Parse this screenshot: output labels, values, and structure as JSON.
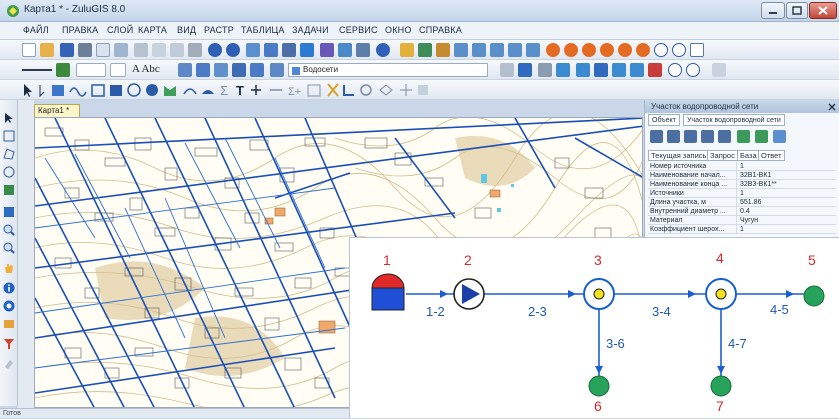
{
  "window": {
    "title": "Карта1 * - ZuluGIS 8.0"
  },
  "menu": [
    "ФАЙЛ",
    "ПРАВКА",
    "СЛОЙ",
    "КАРТА",
    "ВИД",
    "РАСТР",
    "ТАБЛИЦА",
    "ЗАДАЧИ",
    "СЕРВИС",
    "ОКНО",
    "СПРАВКА"
  ],
  "toolbar2": {
    "text_style": "A Abc",
    "layer_name": "Водосети"
  },
  "document_tab": "Карта1 *",
  "panel": {
    "title": "Участок водопроводной сети",
    "tab_object": "Объект",
    "tab_layer": "Участок водопроводной сети",
    "subtabs": [
      "Текущая запись",
      "Запрос",
      "База",
      "Ответ"
    ],
    "rows": [
      {
        "key": "Номер источника",
        "value": "1"
      },
      {
        "key": "Наименование начал...",
        "value": "32В1-ВК1"
      },
      {
        "key": "Наименование конца ...",
        "value": "32В3-ВК1**"
      },
      {
        "key": "Источники",
        "value": "1"
      },
      {
        "key": "Длина участка, м",
        "value": "551.86"
      },
      {
        "key": "Внутренний диаметр ...",
        "value": "0.4"
      },
      {
        "key": "Материал",
        "value": "Чугун"
      },
      {
        "key": "Коэффициент шерох...",
        "value": "1"
      }
    ]
  },
  "status": {
    "left": "Готов"
  },
  "diagram": {
    "nodes": [
      "1",
      "2",
      "3",
      "4",
      "5",
      "6",
      "7"
    ],
    "edges": [
      "1-2",
      "2-3",
      "3-4",
      "4-5",
      "3-6",
      "4-7"
    ],
    "colors": {
      "pipe": "#1a5fd1",
      "node_label": "#d42b2b",
      "tank_top": "#e02a2a",
      "tank_body": "#1f4fd6",
      "consumer": "#27a25a",
      "pump_arrow": "#1d3fa8"
    }
  }
}
